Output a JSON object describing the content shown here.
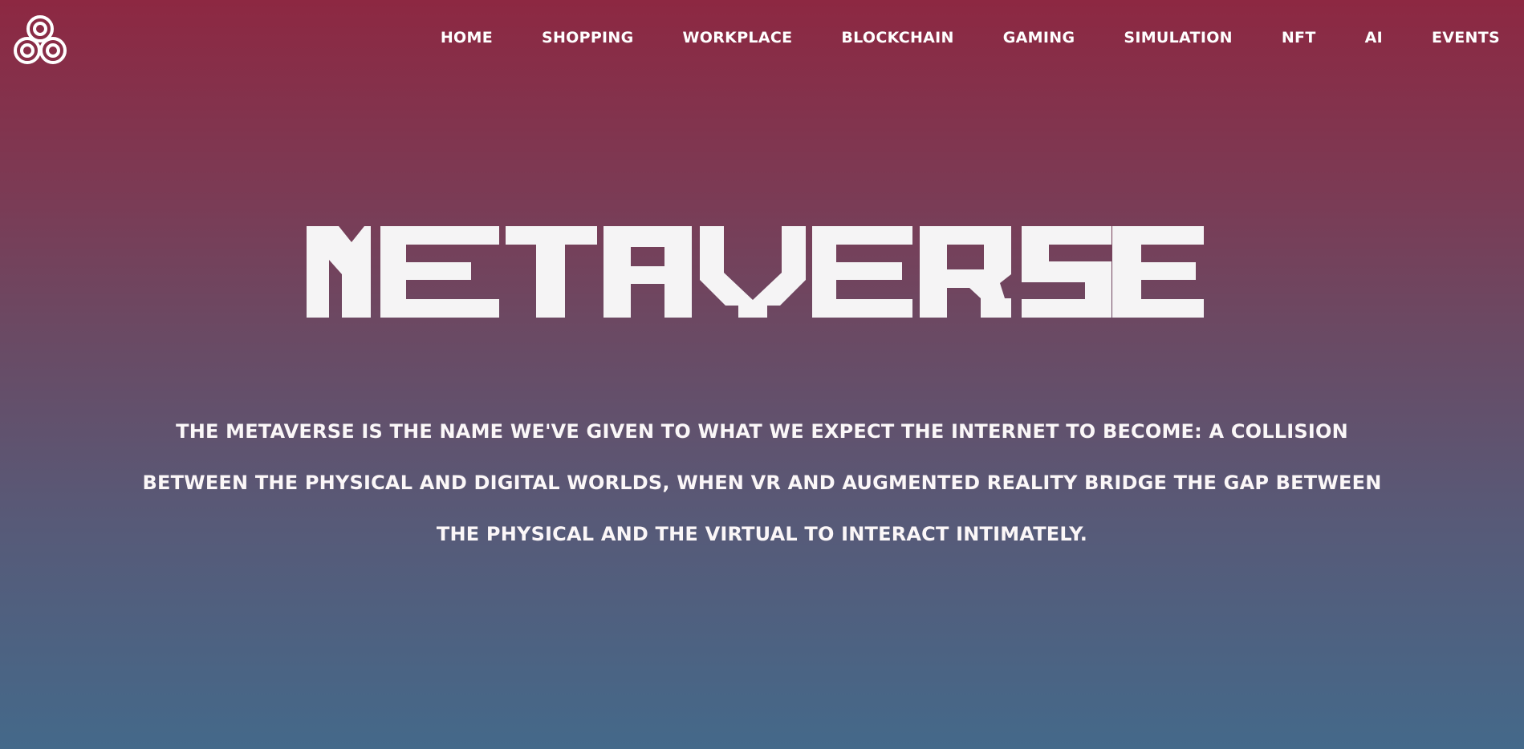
{
  "logo": {
    "icon": "triple-ring-logo-icon"
  },
  "nav": {
    "items": [
      {
        "label": "HOME"
      },
      {
        "label": "SHOPPING"
      },
      {
        "label": "WORKPLACE"
      },
      {
        "label": "BLOCKCHAIN"
      },
      {
        "label": "GAMING"
      },
      {
        "label": "SIMULATION"
      },
      {
        "label": "NFT"
      },
      {
        "label": "AI"
      },
      {
        "label": "EVENTS"
      }
    ]
  },
  "hero": {
    "title": "METAVERSE",
    "description": "The metaverse is the name we've given to what we expect the internet to become: a collision between the physical and digital worlds, when VR and augmented reality bridge the gap between the physical and the virtual to interact intimately."
  },
  "colors": {
    "gradient_top": "#8d2842",
    "gradient_bottom": "#44698a",
    "text": "#f6f4f5"
  }
}
